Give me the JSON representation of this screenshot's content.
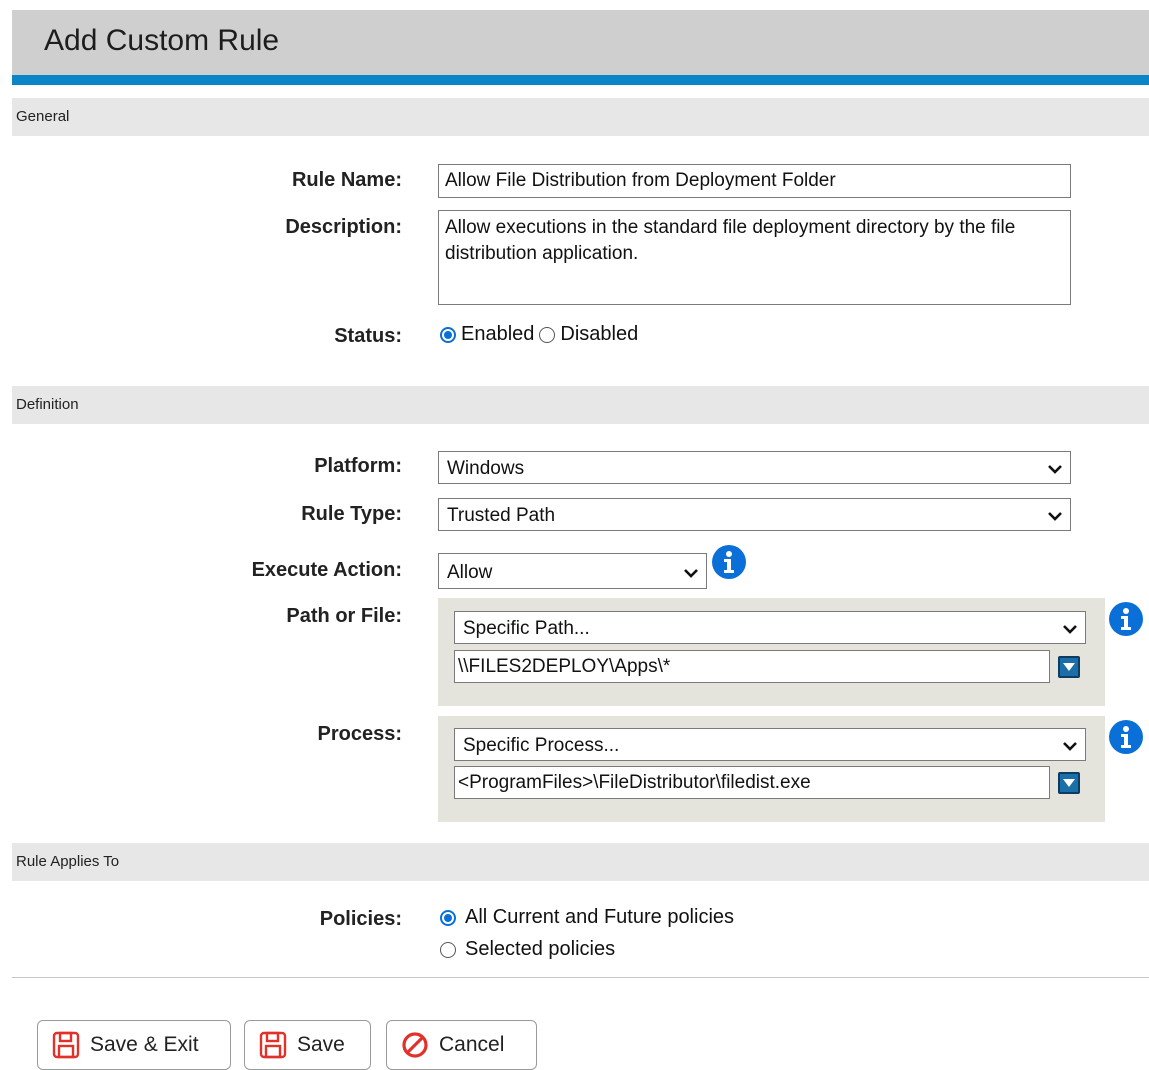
{
  "title": "Add Custom Rule",
  "sections": {
    "general": "General",
    "definition": "Definition",
    "applies_to": "Rule Applies To"
  },
  "general": {
    "rule_name_label": "Rule Name:",
    "rule_name_value": "Allow File Distribution from Deployment Folder",
    "description_label": "Description:",
    "description_value": "Allow executions in the standard file deployment directory by the file distribution application.",
    "status_label": "Status:",
    "status_enabled": "Enabled",
    "status_disabled": "Disabled",
    "status_selected": "Enabled"
  },
  "definition": {
    "platform_label": "Platform:",
    "platform_value": "Windows",
    "rule_type_label": "Rule Type:",
    "rule_type_value": "Trusted Path",
    "execute_action_label": "Execute Action:",
    "execute_action_value": "Allow",
    "path_label": "Path or File:",
    "path_type_value": "Specific Path...",
    "path_value": "\\\\FILES2DEPLOY\\Apps\\*",
    "process_label": "Process:",
    "process_type_value": "Specific Process...",
    "process_value": "<ProgramFiles>\\FileDistributor\\filedist.exe"
  },
  "applies_to": {
    "policies_label": "Policies:",
    "option_all": "All Current and Future policies",
    "option_selected": "Selected policies",
    "selected": "All Current and Future policies"
  },
  "buttons": {
    "save_exit": "Save & Exit",
    "save": "Save",
    "cancel": "Cancel"
  },
  "colors": {
    "accent": "#0a86c8",
    "info_icon": "#0a6fd6",
    "save_icon": "#e0322a",
    "cancel_icon": "#e0322a"
  },
  "icons": [
    "info-icon",
    "chevron-down-icon",
    "dropdown-arrow-icon",
    "save-icon",
    "cancel-icon"
  ]
}
